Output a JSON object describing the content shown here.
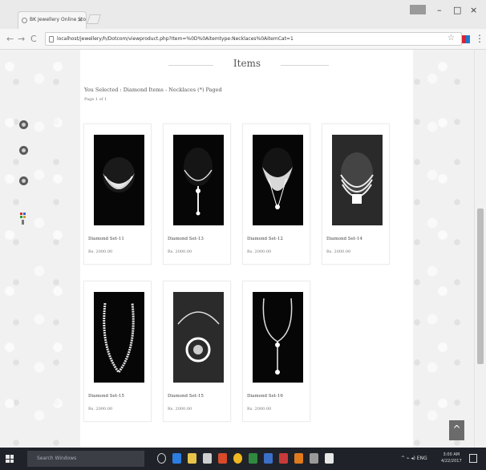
{
  "browser": {
    "tab_title": "BK Jewellery Online Sto",
    "tab_close": "×",
    "address": "localhost/jewellery/h/Dotcom/viewproduct.php?Item=%0D%0Aitemtype:Necklaces%0AitemCat=1",
    "nav_back": "←",
    "nav_forward": "→",
    "nav_reload": "C",
    "star": "☆",
    "menu": "⋮",
    "minimize": "–",
    "maximize": "□",
    "close": "×"
  },
  "page": {
    "heading": "Items",
    "selected_text": "You Selected : Diamond Items - Necklaces (*) Paged",
    "page_info": "Page 1 of 1",
    "products": [
      {
        "name": "Diamond Set-11",
        "price": "Rs. 2000.00",
        "art": "collar"
      },
      {
        "name": "Diamond Set-13",
        "price": "Rs. 2000.00",
        "art": "ydrop"
      },
      {
        "name": "Diamond Set-12",
        "price": "Rs. 2000.00",
        "art": "bib"
      },
      {
        "name": "Diamond Set-14",
        "price": "Rs. 2000.00",
        "art": "strands"
      },
      {
        "name": "Diamond Set-15",
        "price": "Rs. 2000.00",
        "art": "pearl"
      },
      {
        "name": "Diamond Set-15",
        "price": "Rs. 2000.00",
        "art": "pendant"
      },
      {
        "name": "Diamond Set-16",
        "price": "Rs. 2000.00",
        "art": "lariat"
      }
    ],
    "back_to_top": "^"
  },
  "taskbar": {
    "search_placeholder": "Search Windows",
    "tray_text": "^ ⌁ ◂) ENG",
    "time": "3:00 AM",
    "date": "4/22/2017"
  },
  "colors": {
    "chrome": "#eaeaea",
    "page_bg": "#f1f1f1",
    "card_border": "#ededed",
    "taskbar": "#1f2329"
  }
}
